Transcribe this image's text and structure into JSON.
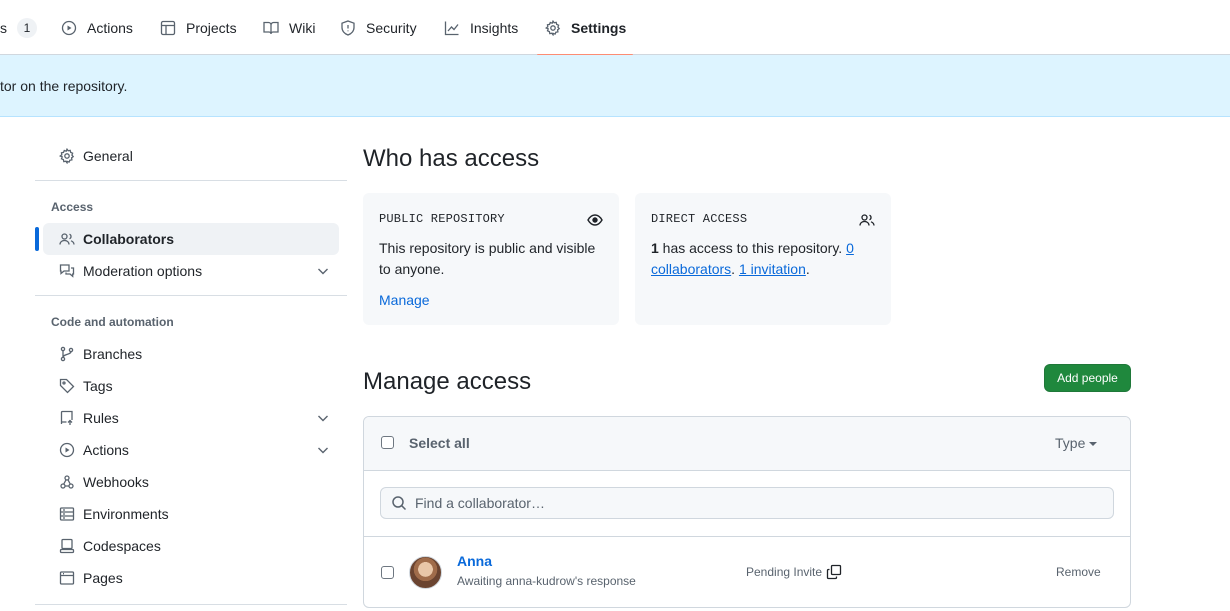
{
  "tabs": [
    {
      "label": "s",
      "counter": "1",
      "icon": "none"
    },
    {
      "label": "Actions",
      "icon": "play-icon"
    },
    {
      "label": "Projects",
      "icon": "table-icon"
    },
    {
      "label": "Wiki",
      "icon": "book-icon"
    },
    {
      "label": "Security",
      "icon": "shield-icon"
    },
    {
      "label": "Insights",
      "icon": "graph-icon"
    },
    {
      "label": "Settings",
      "icon": "gear-icon",
      "active": true
    }
  ],
  "banner": {
    "text": "tor on the repository."
  },
  "sidebar": {
    "general": "General",
    "access_heading": "Access",
    "collaborators": "Collaborators",
    "moderation": "Moderation options",
    "code_heading": "Code and automation",
    "branches": "Branches",
    "tags": "Tags",
    "rules": "Rules",
    "actions": "Actions",
    "webhooks": "Webhooks",
    "environments": "Environments",
    "codespaces": "Codespaces",
    "pages": "Pages"
  },
  "who_has_access": {
    "title": "Who has access",
    "public_card": {
      "label": "PUBLIC REPOSITORY",
      "text": "This repository is public and visible to anyone.",
      "link": "Manage"
    },
    "direct_card": {
      "label": "DIRECT ACCESS",
      "count": "1",
      "text": " has access to this repository. ",
      "collaborators_link": "0 collaborators",
      "sep": ". ",
      "invitation_link": "1 invitation",
      "end": "."
    }
  },
  "manage_access": {
    "title": "Manage access",
    "add_button": "Add people",
    "select_all": "Select all",
    "type_label": "Type",
    "search_placeholder": "Find a collaborator…",
    "rows": [
      {
        "name": "Anna",
        "subtitle": "Awaiting anna-kudrow's response",
        "status": "Pending Invite",
        "action": "Remove"
      }
    ]
  },
  "colors": {
    "accent": "#0969da",
    "primary_button": "#1f883d",
    "banner_bg": "#ddf4ff",
    "tab_underline": "#fd8c73"
  }
}
